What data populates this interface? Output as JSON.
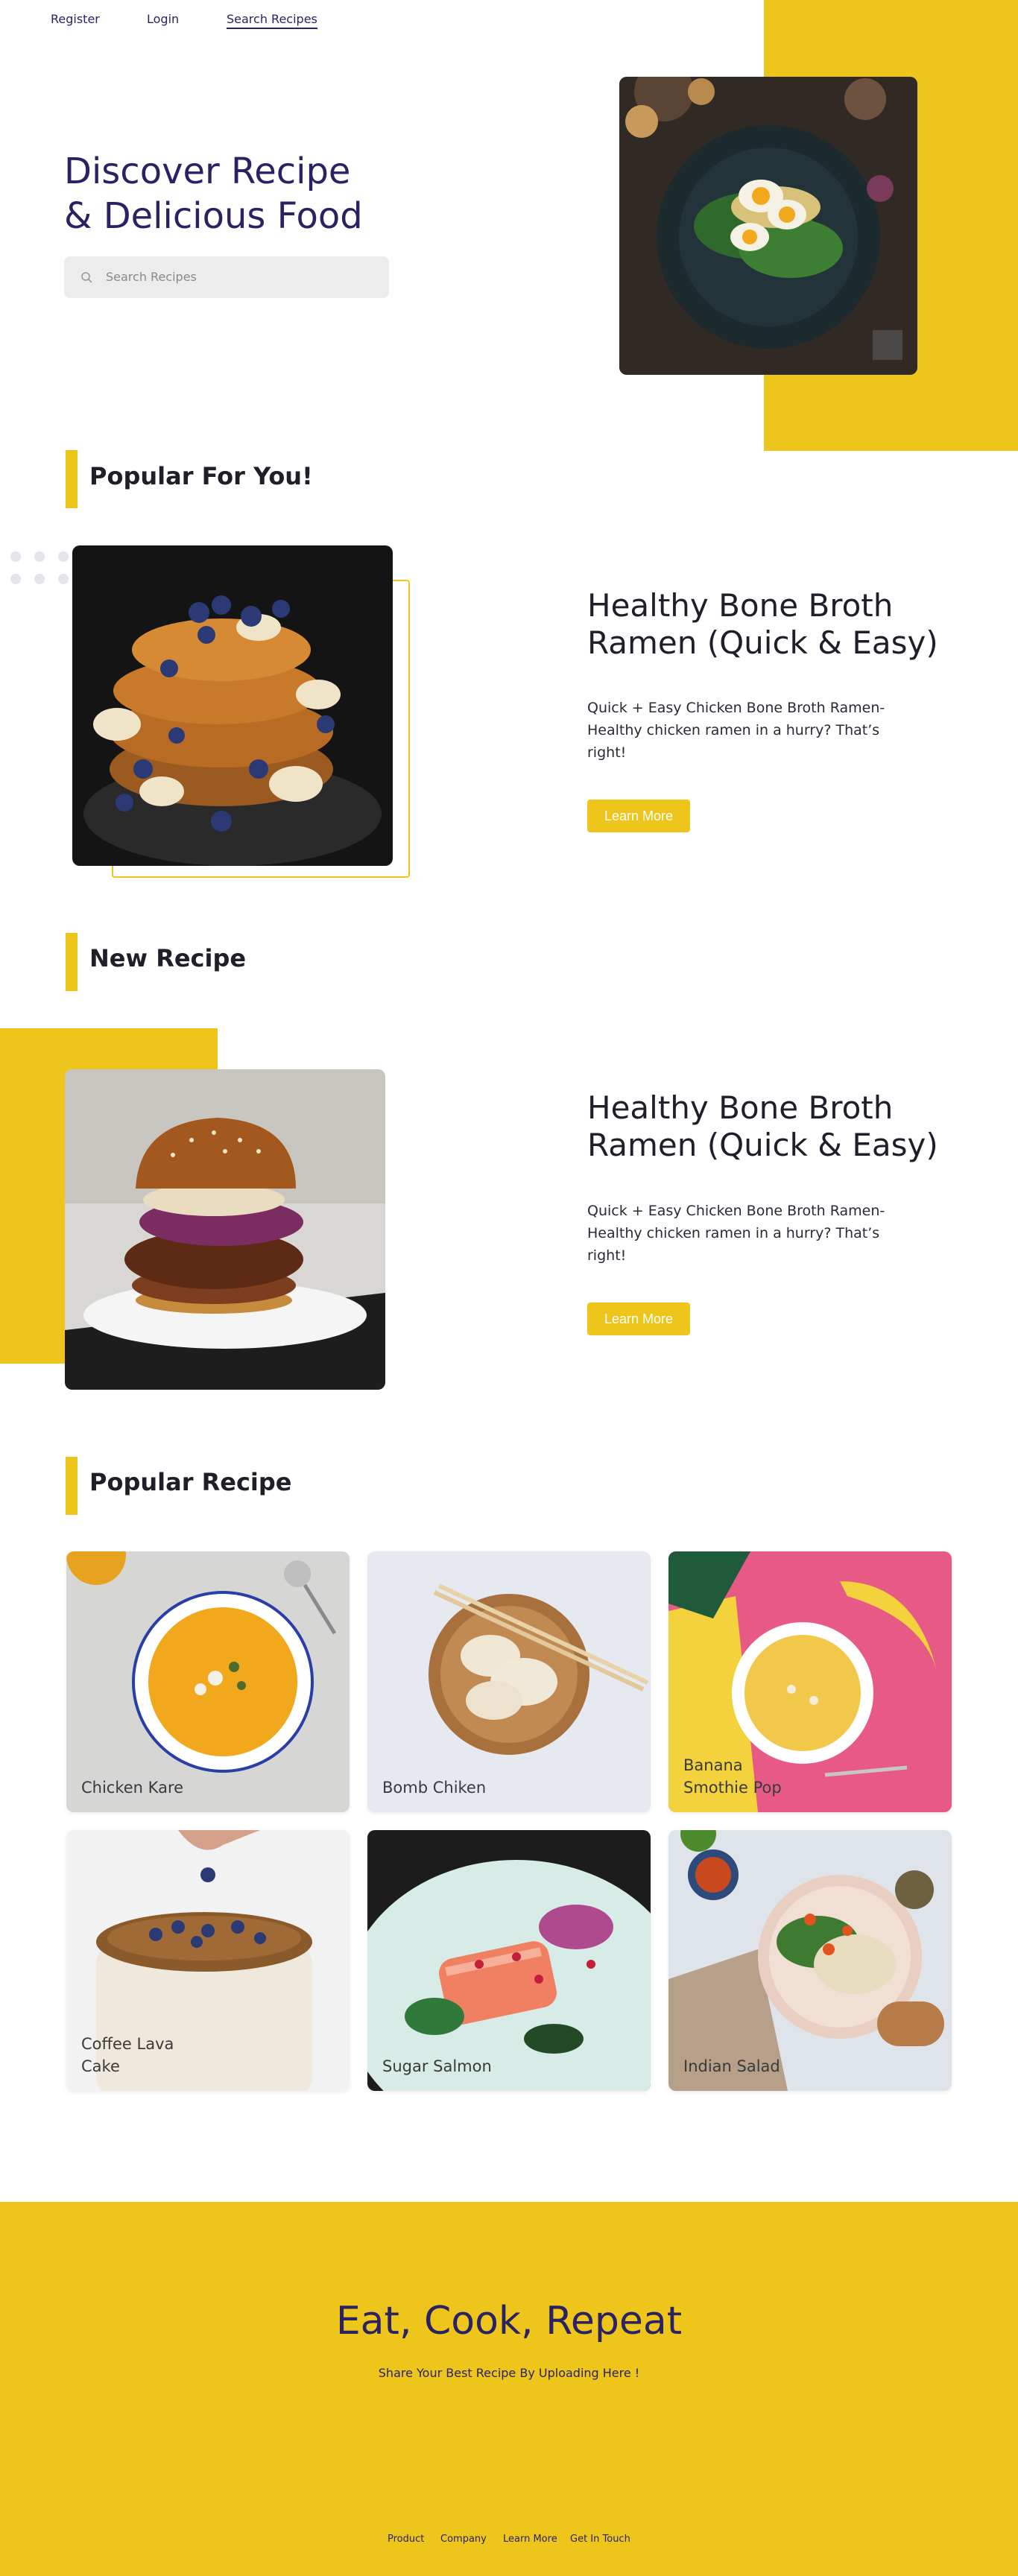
{
  "nav": {
    "register": "Register",
    "login": "Login",
    "search_recipes": "Search Recipes"
  },
  "hero": {
    "title_line1": "Discover Recipe",
    "title_line2": "& Delicious Food",
    "search_placeholder": "Search Recipes"
  },
  "sections": {
    "popular_for_you": "Popular For You!",
    "new_recipe": "New Recipe",
    "popular_recipe": "Popular Recipe"
  },
  "featured": [
    {
      "title_line1": "Healthy Bone Broth",
      "title_line2": "Ramen (Quick & Easy)",
      "description": "Quick + Easy Chicken Bone Broth Ramen- Healthy chicken ramen in a hurry? That’s right!",
      "button": "Learn More"
    },
    {
      "title_line1": "Healthy Bone Broth",
      "title_line2": "Ramen (Quick & Easy)",
      "description": "Quick + Easy Chicken Bone Broth Ramen- Healthy chicken ramen in a hurry? That’s right!",
      "button": "Learn More"
    }
  ],
  "popular_recipes": [
    {
      "line1": "Chicken Kare",
      "line2": ""
    },
    {
      "line1": "Bomb Chiken",
      "line2": ""
    },
    {
      "line1": "Banana",
      "line2": "Smothie Pop"
    },
    {
      "line1": "Coffee Lava",
      "line2": "Cake"
    },
    {
      "line1": "Sugar Salmon",
      "line2": ""
    },
    {
      "line1": "Indian Salad",
      "line2": ""
    }
  ],
  "cta": {
    "title": "Eat, Cook, Repeat",
    "subtitle": "Share Your Best Recipe By Uploading Here !"
  },
  "footer": {
    "links": [
      "Product",
      "Company",
      "Learn More",
      "Get In Touch"
    ]
  },
  "colors": {
    "accent": "#eec61b",
    "brand": "#2b2263"
  },
  "icons": {
    "search": "search-icon"
  }
}
